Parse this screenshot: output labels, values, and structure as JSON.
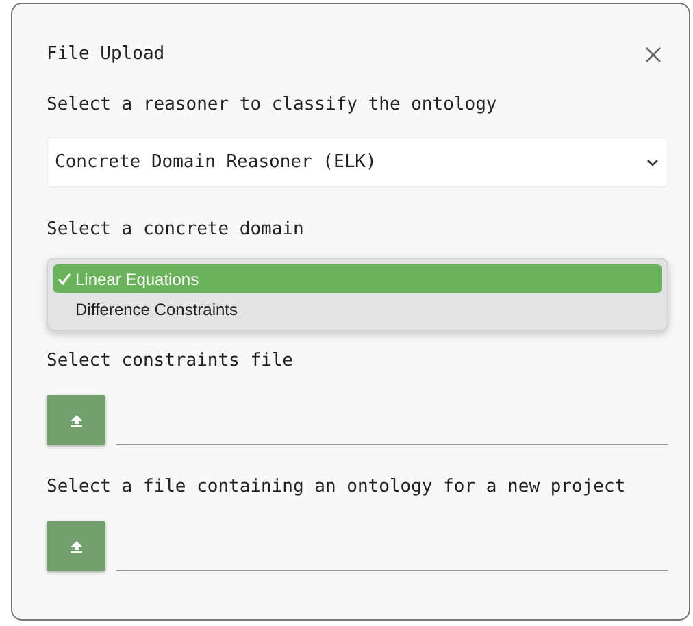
{
  "dialog": {
    "title": "File Upload"
  },
  "reasoner": {
    "label": "Select a reasoner to classify the ontology",
    "value": "Concrete Domain Reasoner (ELK)"
  },
  "concrete_domain": {
    "label": "Select a concrete domain",
    "options": [
      {
        "label": "Linear Equations",
        "selected": true
      },
      {
        "label": "Difference Constraints",
        "selected": false
      }
    ]
  },
  "uploads": [
    {
      "label": "Select constraints file"
    },
    {
      "label": "Select a file containing an ontology for a new project"
    }
  ]
}
